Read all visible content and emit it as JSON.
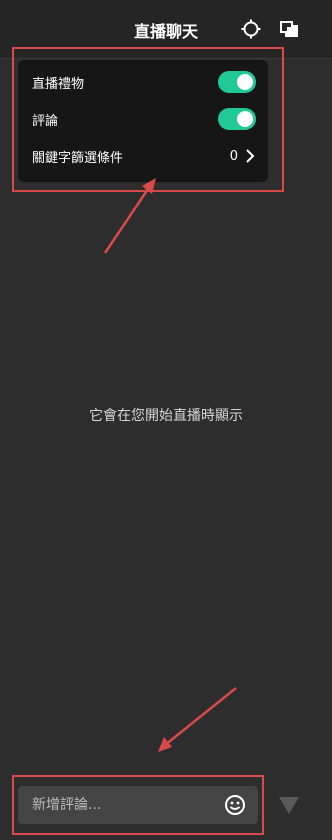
{
  "header": {
    "title": "直播聊天",
    "icons": [
      "gear-icon",
      "popout-icon"
    ]
  },
  "settings_popup": {
    "rows": [
      {
        "label": "直播禮物",
        "enabled": true
      },
      {
        "label": "評論",
        "enabled": true
      },
      {
        "label": "關鍵字篩選條件",
        "count": "0"
      }
    ]
  },
  "chat": {
    "empty_message": "它會在您開始直播時顯示"
  },
  "footer": {
    "comment_placeholder": "新增評論...",
    "icons": [
      "emoji-icon",
      "send-icon"
    ]
  },
  "colors": {
    "background": "#2d2d2d",
    "header_background": "#252525",
    "popup_background": "#161616",
    "toggle_on": "#20c997",
    "annotation_red": "#d84a4a"
  }
}
